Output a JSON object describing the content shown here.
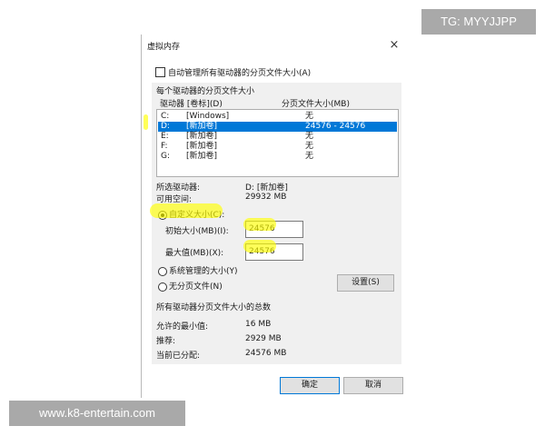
{
  "watermarks": {
    "top_right": "TG: MYYJJPP",
    "bottom_left": "www.k8-entertain.com"
  },
  "dialog": {
    "title": "虚拟内存",
    "close_glyph": "×",
    "auto_manage_label": "自动管理所有驱动器的分页文件大小(A)",
    "auto_manage_checked": false,
    "drives_group": {
      "title": "每个驱动器的分页文件大小",
      "col_drive": "驱动器 [卷标](D)",
      "col_size": "分页文件大小(MB)",
      "rows": [
        {
          "letter": "C:",
          "label": "[Windows]",
          "size": "无",
          "selected": false
        },
        {
          "letter": "D:",
          "label": "[新加卷]",
          "size": "24576 - 24576",
          "selected": true
        },
        {
          "letter": "E:",
          "label": "[新加卷]",
          "size": "无",
          "selected": false
        },
        {
          "letter": "F:",
          "label": "[新加卷]",
          "size": "无",
          "selected": false
        },
        {
          "letter": "G:",
          "label": "[新加卷]",
          "size": "无",
          "selected": false
        }
      ],
      "selected_drive_label": "所选驱动器:",
      "selected_drive_value": "D:  [新加卷]",
      "free_space_label": "可用空间:",
      "free_space_value": "29932 MB",
      "custom_size_label": "自定义大小(C):",
      "initial_size_label": "初始大小(MB)(I):",
      "initial_size_value": "24576",
      "max_size_label": "最大值(MB)(X):",
      "max_size_value": "24576",
      "system_managed_label": "系统管理的大小(Y)",
      "no_paging_label": "无分页文件(N)",
      "selected_option": "custom",
      "set_button": "设置(S)"
    },
    "totals_group": {
      "title": "所有驱动器分页文件大小的总数",
      "min_allowed_label": "允许的最小值:",
      "min_allowed_value": "16 MB",
      "recommended_label": "推荐:",
      "recommended_value": "2929 MB",
      "current_label": "当前已分配:",
      "current_value": "24576 MB"
    },
    "ok_button": "确定",
    "cancel_button": "取消"
  },
  "colors": {
    "selection": "#0078d7",
    "highlight": "#ffff00",
    "panel": "#f0f0f0"
  }
}
